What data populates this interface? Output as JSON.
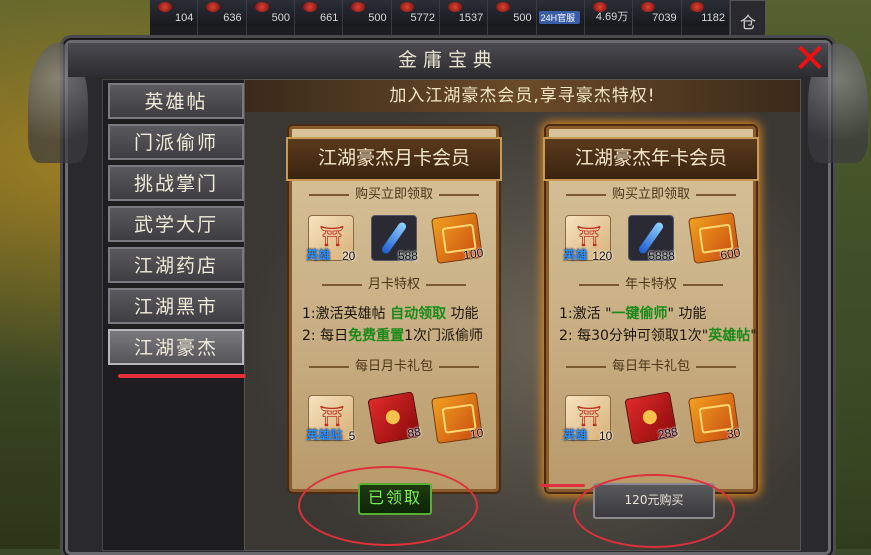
{
  "inventory": {
    "counts": [
      "104",
      "636",
      "500",
      "661",
      "500",
      "5772",
      "1537",
      "500",
      "",
      "4.69万",
      "7039",
      "1182"
    ],
    "badge": "24H官服",
    "side_tab": "仓"
  },
  "window": {
    "title": "金庸宝典",
    "close": "✕"
  },
  "nav": {
    "items": [
      {
        "label": "英雄帖"
      },
      {
        "label": "门派偷师"
      },
      {
        "label": "挑战掌门"
      },
      {
        "label": "武学大厅"
      },
      {
        "label": "江湖药店"
      },
      {
        "label": "江湖黑市"
      },
      {
        "label": "江湖豪杰"
      }
    ],
    "active_index": 6
  },
  "banner": "加入江湖豪杰会员,享寻豪杰特权!",
  "cards": {
    "month": {
      "title": "江湖豪杰月卡会员",
      "purchase_header": "购买立即领取",
      "purchase_items": [
        {
          "label": "英雄",
          "count": "20"
        },
        {
          "count": "588"
        },
        {
          "count": "100"
        }
      ],
      "privilege_header": "月卡特权",
      "privilege_1_pre": "1:激活英雄帖 ",
      "privilege_1_green": "自动领取",
      "privilege_1_post": " 功能",
      "privilege_2_pre": "2: 每日",
      "privilege_2_green": "免费重置",
      "privilege_2_post": "1次门派偷师",
      "daily_header": "每日月卡礼包",
      "daily_items": [
        {
          "label": "英雄贴",
          "count": "5"
        },
        {
          "count": "88"
        },
        {
          "count": "10"
        }
      ],
      "button": "已领取"
    },
    "year": {
      "title": "江湖豪杰年卡会员",
      "purchase_header": "购买立即领取",
      "purchase_items": [
        {
          "label": "英雄",
          "count": "120"
        },
        {
          "count": "5888"
        },
        {
          "count": "600"
        }
      ],
      "privilege_header": "年卡特权",
      "privilege_1_pre": "1:激活 \"",
      "privilege_1_green": "一键偷师",
      "privilege_1_post": "\" 功能",
      "privilege_2_pre": "2: 每30分钟可领取1次\"",
      "privilege_2_green": "英雄帖",
      "privilege_2_post": "\"",
      "daily_header": "每日年卡礼包",
      "daily_items": [
        {
          "label": "英雄",
          "count": "10"
        },
        {
          "count": "288"
        },
        {
          "count": "30"
        }
      ],
      "button": "120元购买"
    }
  },
  "colors": {
    "accent_green": "#1a8a1a",
    "annotation_red": "#e0303c",
    "card_border": "#8a5a2a"
  }
}
